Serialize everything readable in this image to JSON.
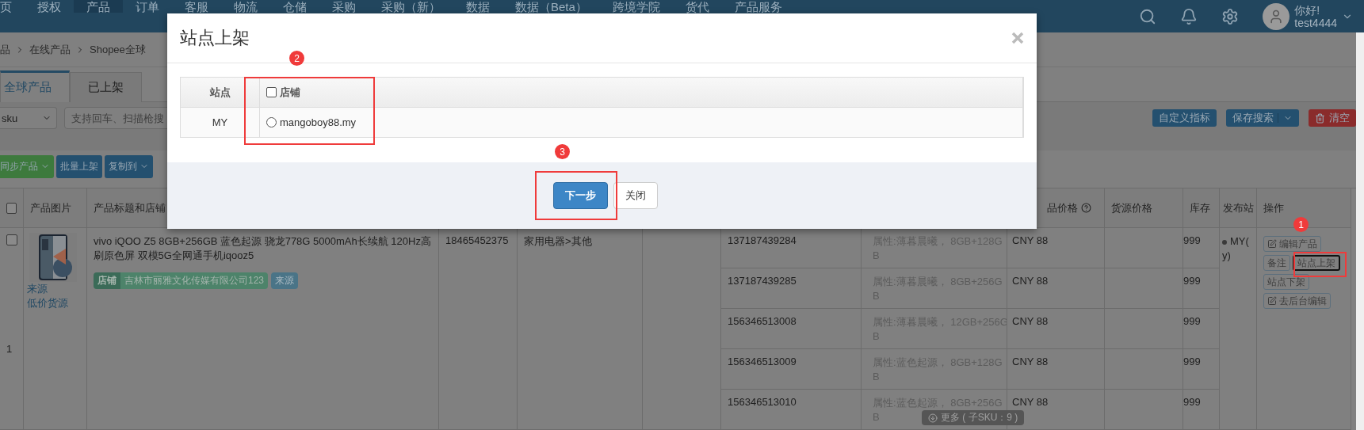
{
  "nav": {
    "items": [
      {
        "label": "页",
        "selected": false
      },
      {
        "label": "授权",
        "selected": false
      },
      {
        "label": "产品",
        "selected": true
      },
      {
        "label": "订单",
        "selected": false
      },
      {
        "label": "客服",
        "selected": false
      },
      {
        "label": "物流",
        "selected": false
      },
      {
        "label": "仓储",
        "selected": false
      },
      {
        "label": "采购",
        "selected": false
      },
      {
        "label": "采购（新）",
        "selected": false
      },
      {
        "label": "数据",
        "selected": false
      },
      {
        "label": "数据（Beta）",
        "selected": false
      },
      {
        "label": "跨境学院",
        "selected": false
      },
      {
        "label": "货代",
        "selected": false
      },
      {
        "label": "产品服务",
        "selected": false
      }
    ],
    "greeting": "你好!",
    "username": "test4444"
  },
  "breadcrumb": [
    "品",
    "在线产品",
    "Shopee全球"
  ],
  "tabs": [
    {
      "label": "全球产品",
      "selected": true
    },
    {
      "label": "已上架",
      "selected": false
    }
  ],
  "filters": {
    "select_value": "sku",
    "search_placeholder": "支持回车、扫描枪搜",
    "buttons": [
      {
        "label": "自定义指标",
        "kind": "plain"
      },
      {
        "label": "保存搜索",
        "kind": "split"
      },
      {
        "label": "清空",
        "kind": "danger"
      }
    ]
  },
  "toolbar": [
    {
      "label": "同步产品",
      "kind": "success",
      "dropdown": true
    },
    {
      "label": "批量上架",
      "kind": "primary",
      "dropdown": false
    },
    {
      "label": "复制到",
      "kind": "primary",
      "dropdown": true
    }
  ],
  "table": {
    "columns": [
      "产品图片",
      "产品标题和店铺",
      "品价格",
      "货源价格",
      "库存",
      "发布站",
      "操作"
    ],
    "header_checked": false,
    "rows": [
      {
        "checked": false,
        "index": "1",
        "links": [
          "来源",
          "低价货源"
        ],
        "title": "vivo iQOO Z5 8GB+256GB 蓝色起源 骁龙778G 5000mAh长续航 120Hz高刷原色屏 双模5G全网通手机iqooz5",
        "shop_label": "店铺",
        "shop_name": "吉林市丽雅文化传媒有限公司123",
        "source_tag": "来源",
        "sku": "18465452375",
        "category": "家用电器>其他",
        "variants": [
          {
            "id": "137187439284",
            "attributes": [
              "属性:薄暮晨曦， 8GB+128G",
              "B"
            ],
            "price": "CNY 88",
            "stock": "999"
          },
          {
            "id": "137187439285",
            "attributes": [
              "属性:薄暮晨曦， 8GB+256G",
              "B"
            ],
            "price": "CNY 88",
            "stock": "999"
          },
          {
            "id": "156346513008",
            "attributes": [
              "属性:薄暮晨曦， 12GB+256G",
              "B"
            ],
            "price": "CNY 88",
            "stock": "999"
          },
          {
            "id": "156346513009",
            "attributes": [
              "属性:蓝色起源， 8GB+128G",
              "B"
            ],
            "price": "CNY 88",
            "stock": "999"
          },
          {
            "id": "156346513010",
            "attributes": [
              "属性:蓝色起源， 8GB+256G",
              "B"
            ],
            "price": "CNY 88",
            "stock": "999"
          }
        ],
        "site_lines": [
          "MY(",
          "y)"
        ],
        "actions": [
          {
            "label": "编辑产品",
            "icon": true,
            "focused": false
          },
          {
            "label": "备注",
            "icon": false,
            "focused": false
          },
          {
            "label": "站点上架",
            "icon": false,
            "focused": true
          },
          {
            "label": "站点下架",
            "icon": false,
            "focused": false
          },
          {
            "label": "去后台编辑",
            "icon": true,
            "focused": false
          }
        ],
        "more": "更多 ( 子SKU：9 )"
      }
    ]
  },
  "modal": {
    "title": "站点上架",
    "columns": [
      "站点",
      "店铺"
    ],
    "select_all_checked": false,
    "rows": [
      {
        "site": "MY",
        "shop": "mangoboy88.my",
        "selected": false
      }
    ],
    "buttons": [
      {
        "label": "下一步",
        "kind": "primary"
      },
      {
        "label": "关闭",
        "kind": "default"
      }
    ]
  },
  "annotations": [
    {
      "label": "2"
    },
    {
      "label": "3"
    },
    {
      "label": "1"
    }
  ]
}
